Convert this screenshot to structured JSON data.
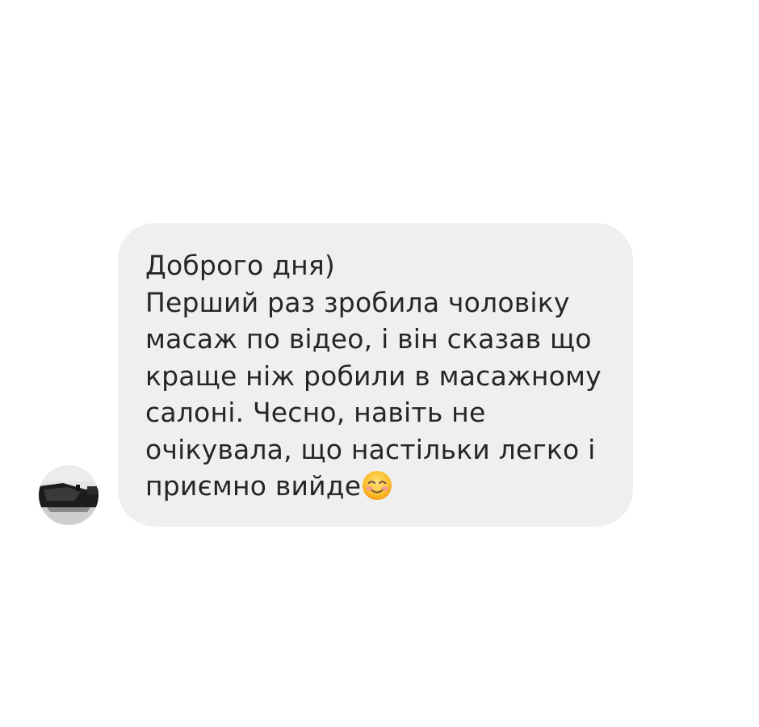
{
  "conversation": {
    "message": {
      "text": "Доброго дня)\nПерший раз зробила чоловіку масаж по відео, і він сказав що краще ніж робили в масажному салоні. Чесно, навіть не очікувала, що настільки легко і приємно вийде",
      "emoji_icon": "smiling-face-with-smiling-eyes-emoji",
      "bubble_color": "#efefef",
      "text_color": "#262626"
    },
    "sender": {
      "avatar_icon": "profile-photo-avatar"
    }
  }
}
